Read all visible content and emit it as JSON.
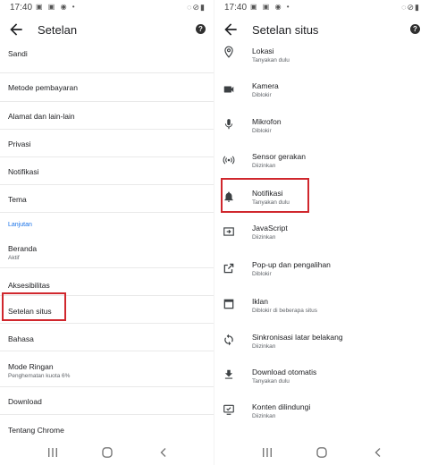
{
  "status": {
    "time": "17:40",
    "left_icons": "▣ ▣ ◉ •",
    "right_icons": "◌⊘▮"
  },
  "left_screen": {
    "title": "Setelan",
    "items": [
      {
        "label": "Sandi",
        "sub": ""
      },
      {
        "label": "Metode pembayaran",
        "sub": ""
      },
      {
        "label": "Alamat dan lain-lain",
        "sub": ""
      },
      {
        "label": "Privasi",
        "sub": ""
      },
      {
        "label": "Notifikasi",
        "sub": ""
      },
      {
        "label": "Tema",
        "sub": ""
      }
    ],
    "section_label": "Lanjutan",
    "advanced_items": [
      {
        "label": "Beranda",
        "sub": "Aktif"
      },
      {
        "label": "Aksesibilitas",
        "sub": ""
      },
      {
        "label": "Setelan situs",
        "sub": "",
        "highlighted": true
      },
      {
        "label": "Bahasa",
        "sub": ""
      },
      {
        "label": "Mode Ringan",
        "sub": "Penghematan kuota 6%"
      },
      {
        "label": "Download",
        "sub": ""
      },
      {
        "label": "Tentang Chrome",
        "sub": ""
      }
    ]
  },
  "right_screen": {
    "title": "Setelan situs",
    "items": [
      {
        "icon": "location-icon",
        "label": "Lokasi",
        "sub": "Tanyakan dulu"
      },
      {
        "icon": "camera-icon",
        "label": "Kamera",
        "sub": "Diblokir"
      },
      {
        "icon": "microphone-icon",
        "label": "Mikrofon",
        "sub": "Diblokir"
      },
      {
        "icon": "motion-sensor-icon",
        "label": "Sensor gerakan",
        "sub": "Diizinkan"
      },
      {
        "icon": "bell-icon",
        "label": "Notifikasi",
        "sub": "Tanyakan dulu",
        "highlighted": true
      },
      {
        "icon": "javascript-icon",
        "label": "JavaScript",
        "sub": "Diizinkan"
      },
      {
        "icon": "popup-icon",
        "label": "Pop-up dan pengalihan",
        "sub": "Diblokir"
      },
      {
        "icon": "ads-icon",
        "label": "Iklan",
        "sub": "Diblokir di beberapa situs"
      },
      {
        "icon": "sync-icon",
        "label": "Sinkronisasi latar belakang",
        "sub": "Diizinkan"
      },
      {
        "icon": "download-icon",
        "label": "Download otomatis",
        "sub": "Tanyakan dulu"
      },
      {
        "icon": "protected-content-icon",
        "label": "Konten dilindungi",
        "sub": "Diizinkan"
      }
    ]
  },
  "colors": {
    "accent": "#1a73e8",
    "highlight": "#d0272d",
    "text": "#202124",
    "subtext": "#5f6368"
  }
}
